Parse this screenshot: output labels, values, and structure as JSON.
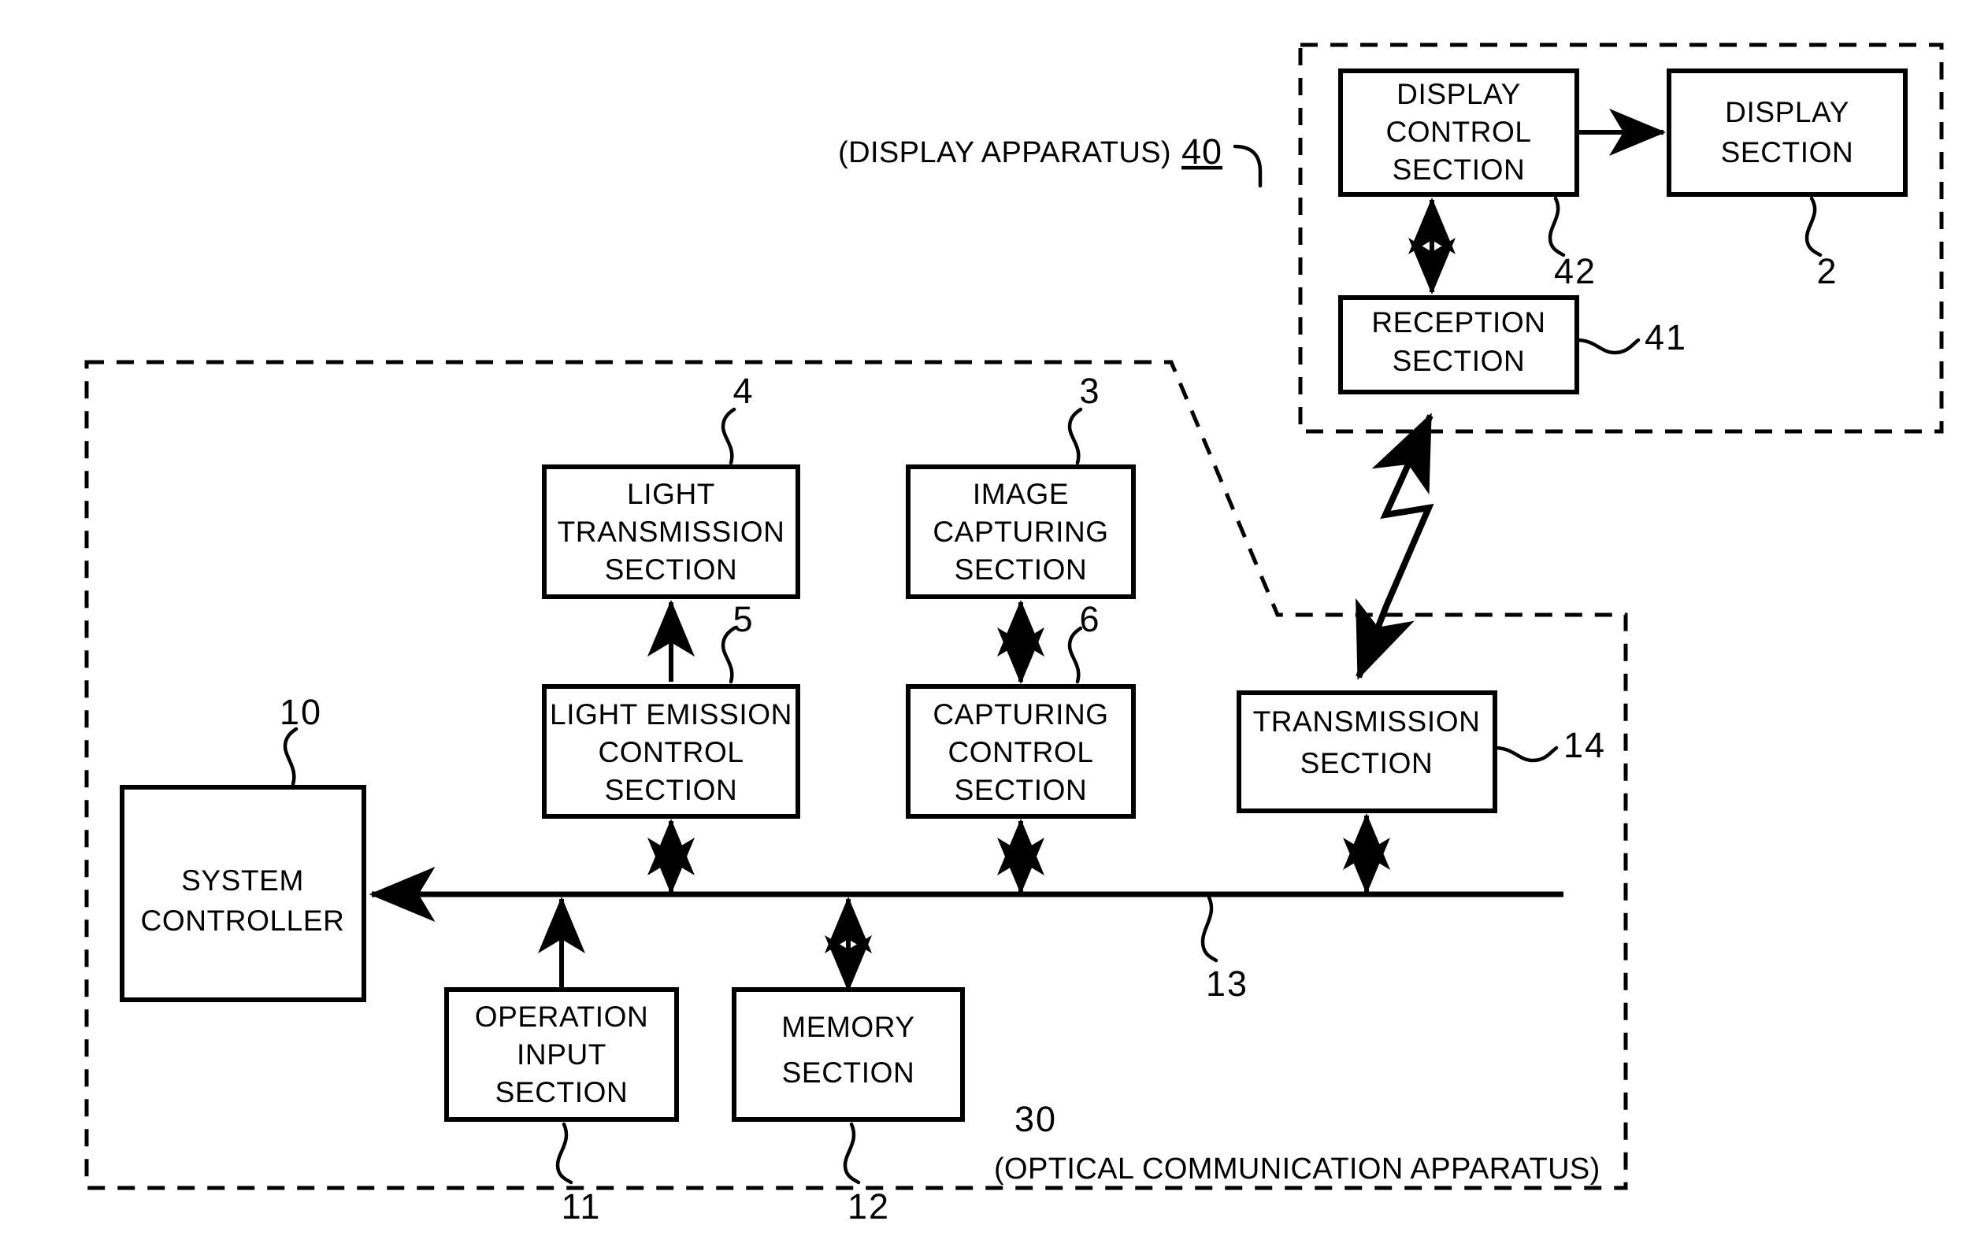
{
  "figure": {
    "type": "patent-block-diagram",
    "background_color": "#ffffff",
    "line_color": "#000000"
  },
  "display_apparatus": {
    "caption": "(DISPLAY APPARATUS)",
    "caption_ref": "40",
    "boxes": {
      "display_control": {
        "lines": [
          "DISPLAY",
          "CONTROL",
          "SECTION"
        ],
        "ref": "42"
      },
      "display": {
        "lines": [
          "DISPLAY",
          "SECTION"
        ],
        "ref": "2"
      },
      "reception": {
        "lines": [
          "RECEPTION",
          "SECTION"
        ],
        "ref": "41"
      }
    }
  },
  "optical_apparatus": {
    "caption_ref": "30",
    "caption": "(OPTICAL COMMUNICATION APPARATUS)",
    "boxes": {
      "light_transmission": {
        "lines": [
          "LIGHT",
          "TRANSMISSION",
          "SECTION"
        ],
        "ref": "4"
      },
      "light_emission_control": {
        "lines": [
          "LIGHT  EMISSION",
          "CONTROL",
          "SECTION"
        ],
        "ref": "5"
      },
      "image_capturing": {
        "lines": [
          "IMAGE",
          "CAPTURING",
          "SECTION"
        ],
        "ref": "3"
      },
      "capturing_control": {
        "lines": [
          "CAPTURING",
          "CONTROL",
          "SECTION"
        ],
        "ref": "6"
      },
      "transmission": {
        "lines": [
          "TRANSMISSION",
          "SECTION"
        ],
        "ref": "14"
      },
      "system_controller": {
        "lines": [
          "SYSTEM",
          "CONTROLLER"
        ],
        "ref": "10"
      },
      "operation_input": {
        "lines": [
          "OPERATION",
          "INPUT",
          "SECTION"
        ],
        "ref": "11"
      },
      "memory": {
        "lines": [
          "MEMORY",
          "SECTION"
        ],
        "ref": "12"
      }
    },
    "bus": {
      "ref": "13"
    }
  }
}
